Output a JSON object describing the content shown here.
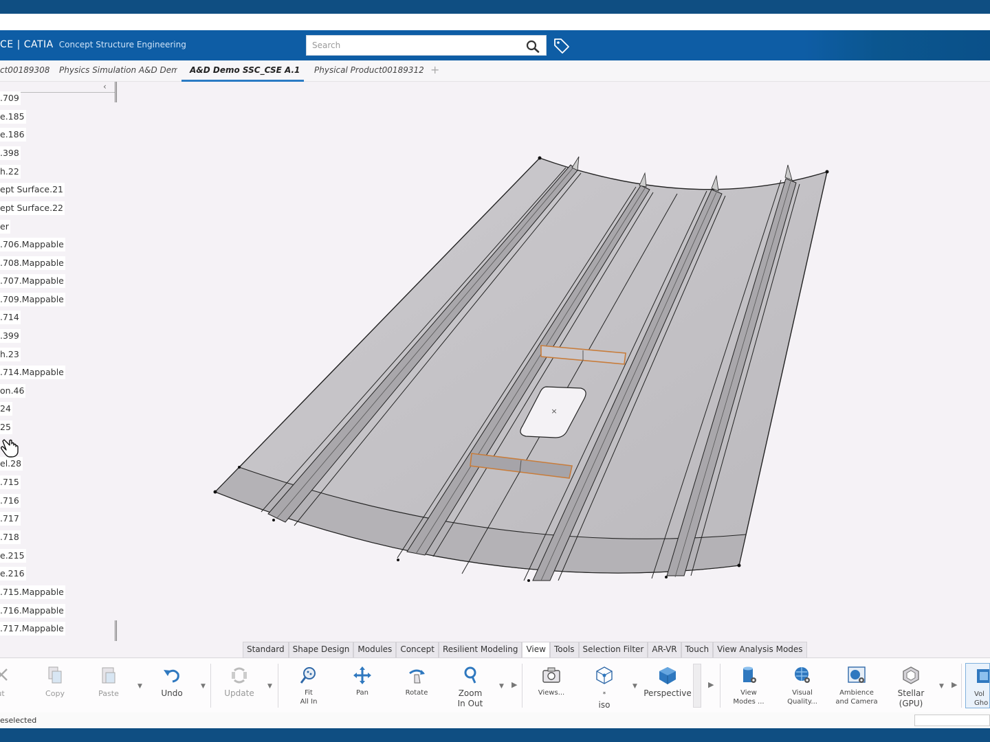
{
  "header": {
    "brand": "CE | CATIA",
    "app_name": "Concept Structure Engineering",
    "search_placeholder": "Search"
  },
  "tabs": [
    {
      "label": "ct00189308",
      "active": false
    },
    {
      "label": "Physics Simulation A&D Dem",
      "active": false
    },
    {
      "label": "A&D Demo SSC_CSE A.1",
      "active": true
    },
    {
      "label": "Physical Product00189312",
      "active": false
    }
  ],
  "tree": {
    "items": [
      ".709",
      "e.185",
      "e.186",
      ".398",
      "h.22",
      "ept Surface.21",
      "ept Surface.22",
      "er",
      ".706.Mappable",
      ".708.Mappable",
      ".707.Mappable",
      ".709.Mappable",
      ".714",
      ".399",
      "h.23",
      ".714.Mappable",
      "on.46",
      "24",
      "25",
      "",
      "el.28",
      ".715",
      ".716",
      ".717",
      ".718",
      "e.215",
      "e.216",
      ".715.Mappable",
      ".716.Mappable",
      ".717.Mappable"
    ]
  },
  "ribbon": {
    "tabs": [
      "Standard",
      "Shape Design",
      "Modules",
      "Concept",
      "Resilient Modeling",
      "View",
      "Tools",
      "Selection Filter",
      "AR-VR",
      "Touch",
      "View Analysis Modes"
    ],
    "active_tab": "View",
    "tools": {
      "cut": "ut",
      "copy": "Copy",
      "paste": "Paste",
      "undo": "Undo",
      "update": "Update",
      "fit_all_in_1": "Fit",
      "fit_all_in_2": "All In",
      "pan": "Pan",
      "rotate": "Rotate",
      "zoom_1": "Zoom",
      "zoom_2": "In Out",
      "views": "Views...",
      "iso_star": "*",
      "iso": "iso",
      "perspective": "Perspective",
      "view_modes_1": "View",
      "view_modes_2": "Modes ...",
      "visual_quality_1": "Visual",
      "visual_quality_2": "Quality...",
      "ambience_1": "Ambience",
      "ambience_2": "and Camera",
      "stellar_1": "Stellar",
      "stellar_2": "(GPU)",
      "vol_1": "Vol",
      "vol_2": "Gho"
    }
  },
  "status": {
    "text": "eselected"
  },
  "colors": {
    "header_blue": "#0e5da5",
    "frame_blue": "#0f4e82",
    "tab_underline": "#2a7bc4",
    "panel_gray": "#c4c2c6"
  }
}
